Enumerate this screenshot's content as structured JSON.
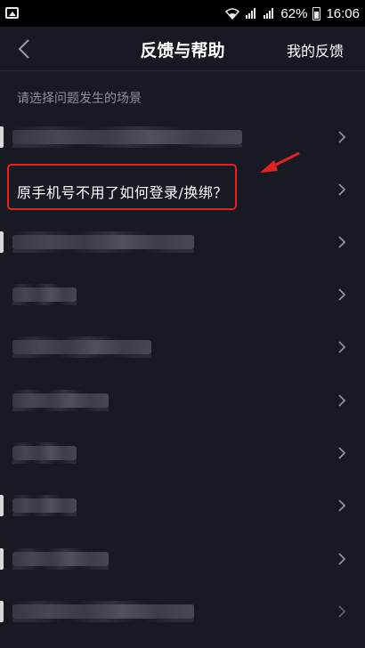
{
  "status_bar": {
    "battery_percent": "62%",
    "time": "16:06"
  },
  "header": {
    "title": "反馈与帮助",
    "right_action": "我的反馈"
  },
  "section_label": "请选择问题发生的场景",
  "highlighted_item": "原手机号不用了如何登录/换绑？",
  "colors": {
    "background": "#171923",
    "highlight": "#e0231e",
    "muted_text": "#8e909a"
  }
}
